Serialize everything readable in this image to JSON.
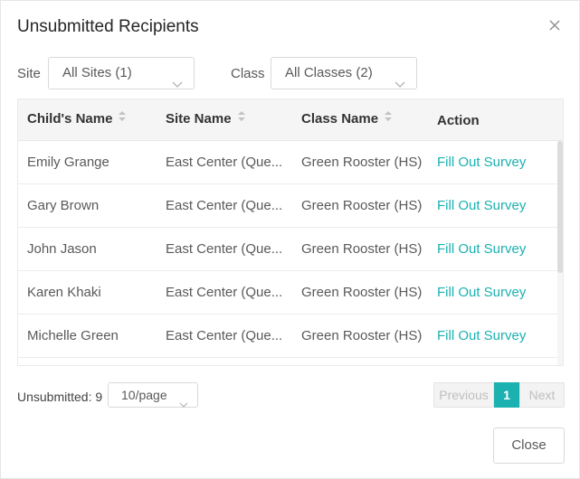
{
  "dialog": {
    "title": "Unsubmitted Recipients"
  },
  "filters": {
    "site_label": "Site",
    "site_value": "All Sites (1)",
    "class_label": "Class",
    "class_value": "All Classes (2)"
  },
  "table": {
    "columns": [
      {
        "label": "Child's Name",
        "sortable": true
      },
      {
        "label": "Site Name",
        "sortable": true
      },
      {
        "label": "Class Name",
        "sortable": true
      },
      {
        "label": "Action",
        "sortable": false
      }
    ],
    "rows": [
      {
        "child": "Emily Grange",
        "site": "East Center (Que...",
        "class": "Green Rooster (HS)",
        "action": "Fill Out Survey"
      },
      {
        "child": "Gary Brown",
        "site": "East Center (Que...",
        "class": "Green Rooster (HS)",
        "action": "Fill Out Survey"
      },
      {
        "child": "John Jason",
        "site": "East Center (Que...",
        "class": "Green Rooster (HS)",
        "action": "Fill Out Survey"
      },
      {
        "child": "Karen Khaki",
        "site": "East Center (Que...",
        "class": "Green Rooster (HS)",
        "action": "Fill Out Survey"
      },
      {
        "child": "Michelle Green",
        "site": "East Center (Que...",
        "class": "Green Rooster (HS)",
        "action": "Fill Out Survey"
      }
    ]
  },
  "footer": {
    "unsubmitted_label": "Unsubmitted: 9",
    "page_size": "10/page",
    "prev_label": "Previous",
    "current_page": "1",
    "next_label": "Next",
    "close_label": "Close"
  },
  "colors": {
    "accent": "#1bb1b1",
    "header_bg": "#f5f5f5"
  }
}
